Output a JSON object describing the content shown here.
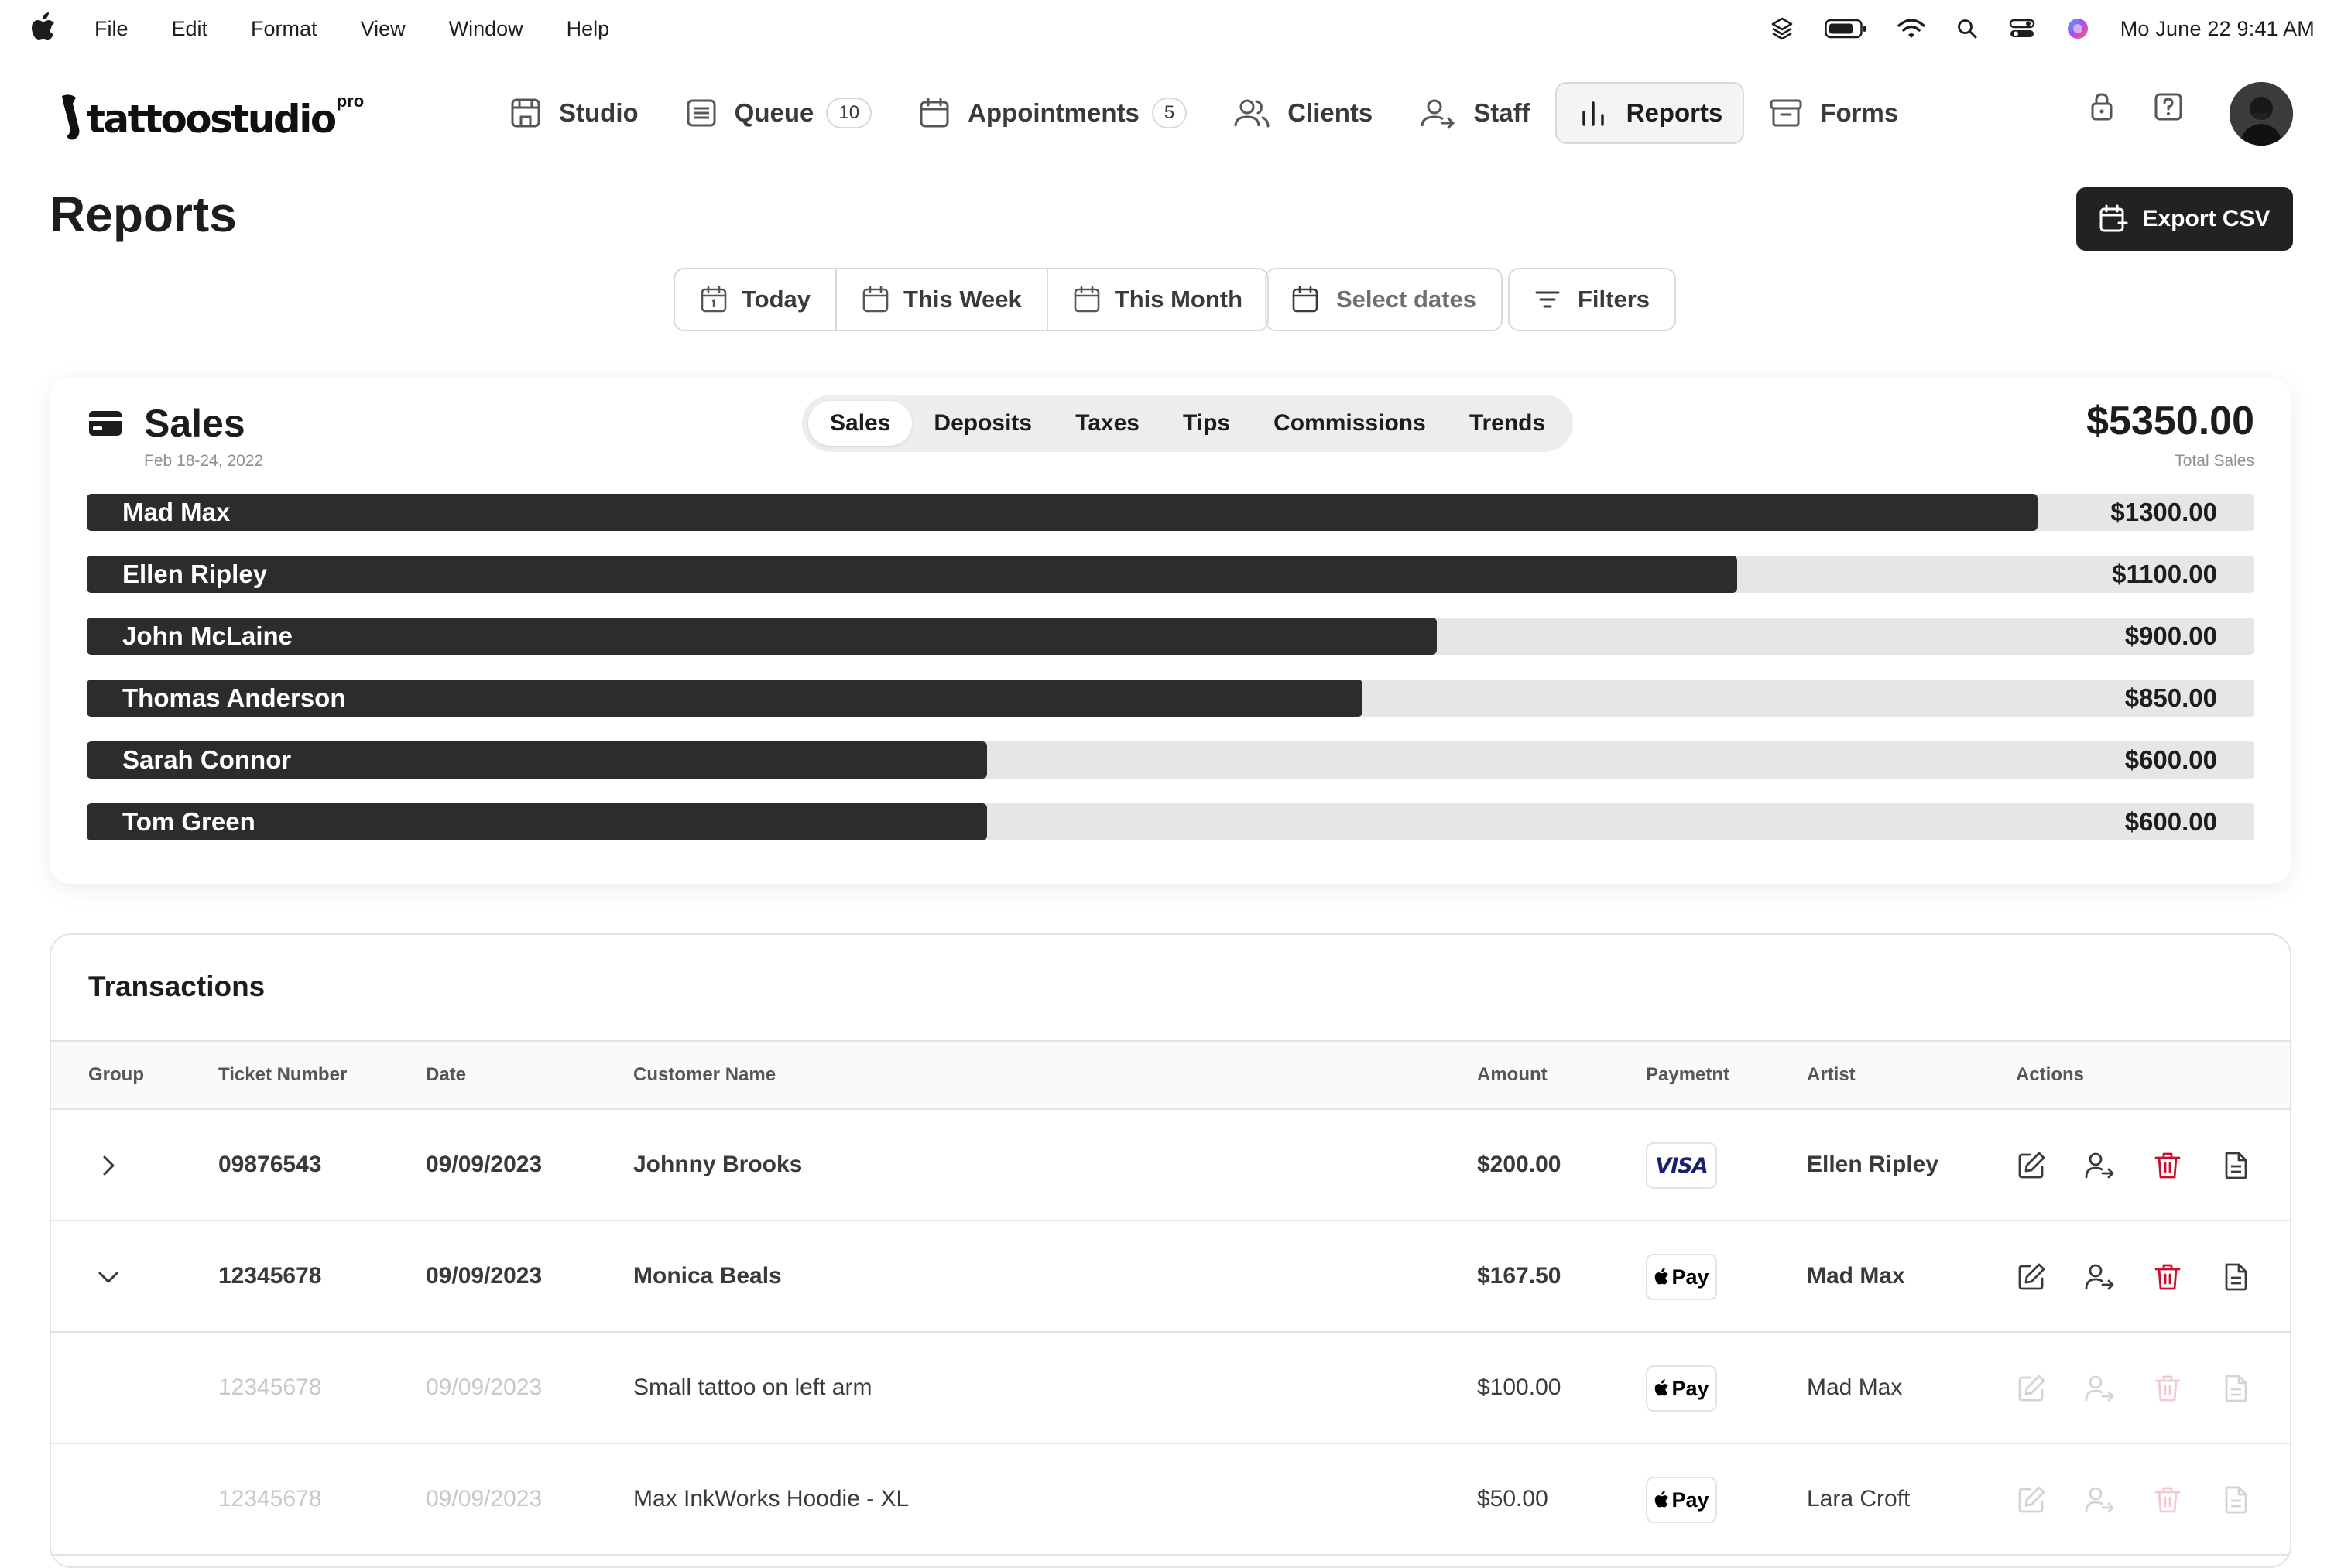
{
  "menubar": {
    "menus": [
      "File",
      "Edit",
      "Format",
      "View",
      "Window",
      "Help"
    ],
    "clock": "Mo June 22  9:41 AM",
    "icons": [
      "apple-icon",
      "layers-icon",
      "battery-icon",
      "wifi-icon",
      "search-icon",
      "control-center-icon",
      "siri-icon"
    ]
  },
  "brand": {
    "name": "tattoostudio",
    "tier": "pro"
  },
  "nav": {
    "items": [
      {
        "label": "Studio",
        "icon": "store-icon",
        "badge": null
      },
      {
        "label": "Queue",
        "icon": "list-icon",
        "badge": "10"
      },
      {
        "label": "Appointments",
        "icon": "calendar-icon",
        "badge": "5"
      },
      {
        "label": "Clients",
        "icon": "users-icon",
        "badge": null
      },
      {
        "label": "Staff",
        "icon": "staff-icon",
        "badge": null
      },
      {
        "label": "Reports",
        "icon": "bar-chart-icon",
        "badge": null,
        "active": true
      },
      {
        "label": "Forms",
        "icon": "archive-icon",
        "badge": null
      }
    ]
  },
  "page": {
    "title": "Reports",
    "export_label": "Export CSV",
    "ranges": [
      "Today",
      "This Week",
      "This Month"
    ],
    "select_dates_placeholder": "Select dates",
    "filters_label": "Filters"
  },
  "sales": {
    "title": "Sales",
    "period": "Feb 18-24, 2022",
    "tabs": [
      "Sales",
      "Deposits",
      "Taxes",
      "Tips",
      "Commissions",
      "Trends"
    ],
    "active_tab": "Sales",
    "total": "$5350.00",
    "total_label": "Total Sales",
    "max": 1444.6,
    "rows": [
      {
        "name": "Mad Max",
        "value": 1300,
        "label": "$1300.00"
      },
      {
        "name": "Ellen Ripley",
        "value": 1100,
        "label": "$1100.00"
      },
      {
        "name": "John McLaine",
        "value": 900,
        "label": "$900.00"
      },
      {
        "name": "Thomas Anderson",
        "value": 850,
        "label": "$850.00"
      },
      {
        "name": "Sarah Connor",
        "value": 600,
        "label": "$600.00"
      },
      {
        "name": "Tom Green",
        "value": 600,
        "label": "$600.00"
      }
    ]
  },
  "transactions": {
    "title": "Transactions",
    "columns": [
      "Group",
      "Ticket Number",
      "Date",
      "Customer Name",
      "Amount",
      "Paymetnt",
      "Artist",
      "Actions"
    ],
    "rows": [
      {
        "expand": "collapsed",
        "ticket": "09876543",
        "date": "09/09/2023",
        "customer": "Johnny Brooks",
        "amount": "$200.00",
        "payment": "VISA",
        "artist": "Ellen Ripley",
        "kind": "parent"
      },
      {
        "expand": "expanded",
        "ticket": "12345678",
        "date": "09/09/2023",
        "customer": "Monica Beals",
        "amount": "$167.50",
        "payment": "Pay",
        "artist": "Mad Max",
        "kind": "parent"
      },
      {
        "expand": "none",
        "ticket": "12345678",
        "date": "09/09/2023",
        "customer": "Small tattoo on left arm",
        "amount": "$100.00",
        "payment": "Pay",
        "artist": "Mad Max",
        "kind": "child"
      },
      {
        "expand": "none",
        "ticket": "12345678",
        "date": "09/09/2023",
        "customer": "Max InkWorks Hoodie - XL",
        "amount": "$50.00",
        "payment": "Pay",
        "artist": "Lara Croft",
        "kind": "child"
      }
    ],
    "action_icons": [
      "edit-icon",
      "reassign-user-icon",
      "delete-icon",
      "document-icon"
    ]
  },
  "colors": {
    "bar_fill": "#2c2c2e",
    "bar_track": "#e6e6e8",
    "delete": "#c8102e",
    "visa": "#1a1f71",
    "primary_button": "#222224"
  }
}
